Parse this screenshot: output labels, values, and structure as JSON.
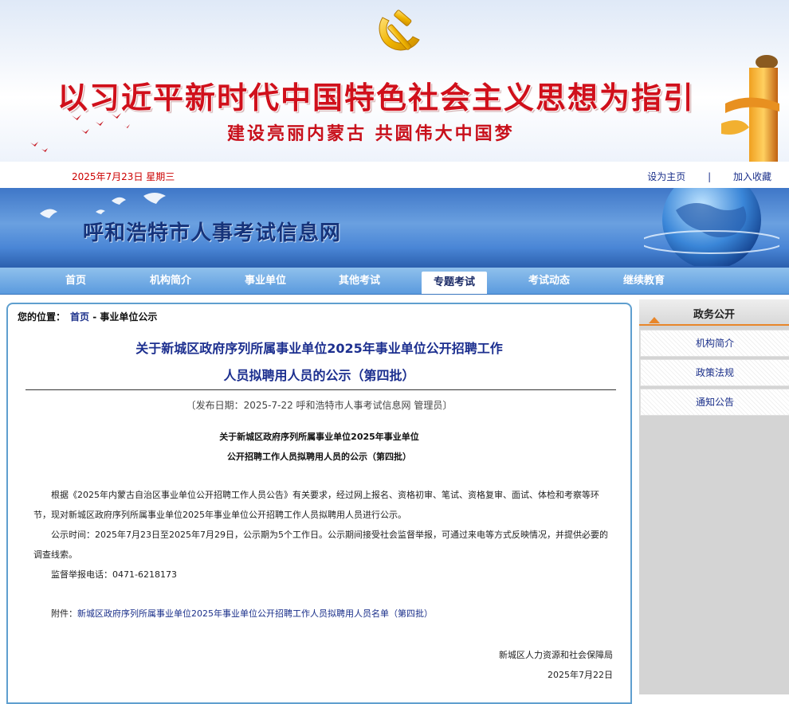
{
  "banner": {
    "slogan": "以习近平新时代中国特色社会主义思想为指引",
    "subslogan": "建设亮丽内蒙古 共圆伟大中国梦"
  },
  "datebar": {
    "date": "2025年7月23日 星期三",
    "set_home": "设为主页",
    "separator": "|",
    "add_favorite": "加入收藏"
  },
  "site": {
    "title": "呼和浩特市人事考试信息网"
  },
  "nav": {
    "items": [
      "首页",
      "机构简介",
      "事业单位",
      "其他考试",
      "专题考试",
      "考试动态",
      "继续教育"
    ],
    "active": "专题考试"
  },
  "breadcrumb": {
    "label": "您的位置：",
    "home": "首页",
    "sep": " - ",
    "current": "事业单位公示"
  },
  "article": {
    "title_line1": "关于新城区政府序列所属事业单位2025年事业单位公开招聘工作",
    "title_line2": "人员拟聘用人员的公示（第四批）",
    "pubinfo": "〔发布日期：2025-7-22 呼和浩特市人事考试信息网 管理员〕",
    "subtitle_line1": "关于新城区政府序列所属事业单位2025年事业单位",
    "subtitle_line2": "公开招聘工作人员拟聘用人员的公示（第四批）",
    "para1": "根据《2025年内蒙古自治区事业单位公开招聘工作人员公告》有关要求，经过网上报名、资格初审、笔试、资格复审、面试、体检和考察等环节，现对新城区政府序列所属事业单位2025年事业单位公开招聘工作人员拟聘用人员进行公示。",
    "para2": "公示时间：2025年7月23日至2025年7月29日，公示期为5个工作日。公示期间接受社会监督举报，可通过来电等方式反映情况，并提供必要的调查线索。",
    "para3": "监督举报电话：0471-6218173",
    "attach_label": "附件：",
    "attach_link": "新城区政府序列所属事业单位2025年事业单位公开招聘工作人员拟聘用人员名单（第四批）",
    "signer": "新城区人力资源和社会保障局",
    "sign_date": "2025年7月22日"
  },
  "sidebar": {
    "heading": "政务公开",
    "items": [
      "机构简介",
      "政策法规",
      "通知公告"
    ]
  },
  "colors": {
    "slogan_red": "#d0101b",
    "link_blue": "#1a2f8a",
    "title_blue": "#1c2f8f",
    "nav_blue": "#5a9ade",
    "accent_orange": "#e8862a"
  }
}
